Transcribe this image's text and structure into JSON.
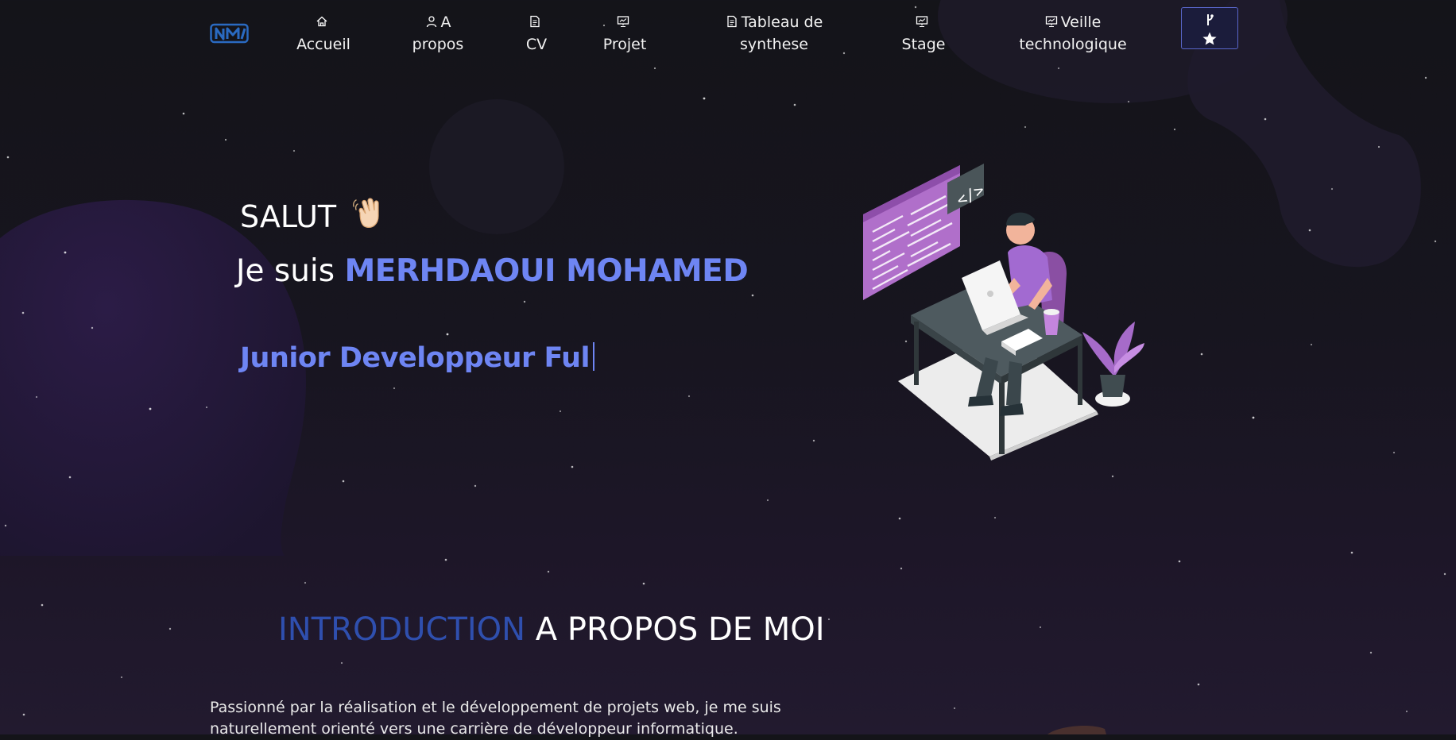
{
  "nav": {
    "logo": "NM",
    "items": [
      {
        "label_top": "",
        "label": "Accueil",
        "icon": "home-icon"
      },
      {
        "label_top": "A",
        "label": "propos",
        "icon": "user-icon"
      },
      {
        "label_top": "",
        "label": "CV",
        "icon": "document-icon"
      },
      {
        "label_top": "",
        "label": "Projet",
        "icon": "presentation-icon"
      },
      {
        "label_top": "Tableau de",
        "label": "synthese",
        "icon": "document-icon"
      },
      {
        "label_top": "",
        "label": "Stage",
        "icon": "presentation-icon"
      },
      {
        "label_top": "Veille",
        "label": "technologique",
        "icon": "presentation-icon"
      }
    ],
    "github": {
      "icons": [
        "fork-icon",
        "star-icon"
      ]
    }
  },
  "hero": {
    "greeting": "SALUT",
    "intro_prefix": "Je suis",
    "name": "MERHDAOUI MOHAMED",
    "typed_text": "Junior Developpeur Ful"
  },
  "about": {
    "title_accent": "INTRODUCTION",
    "title_rest": "A PROPOS DE MOI",
    "paragraph": "Passionné par la réalisation et le développement de projets web, je me suis naturellement orienté vers une carrière de développeur informatique."
  },
  "colors": {
    "accent": "#6e85f3",
    "title_accent": "#2f4fae",
    "background": "#151419",
    "purple_blob": "#2b1b45"
  }
}
